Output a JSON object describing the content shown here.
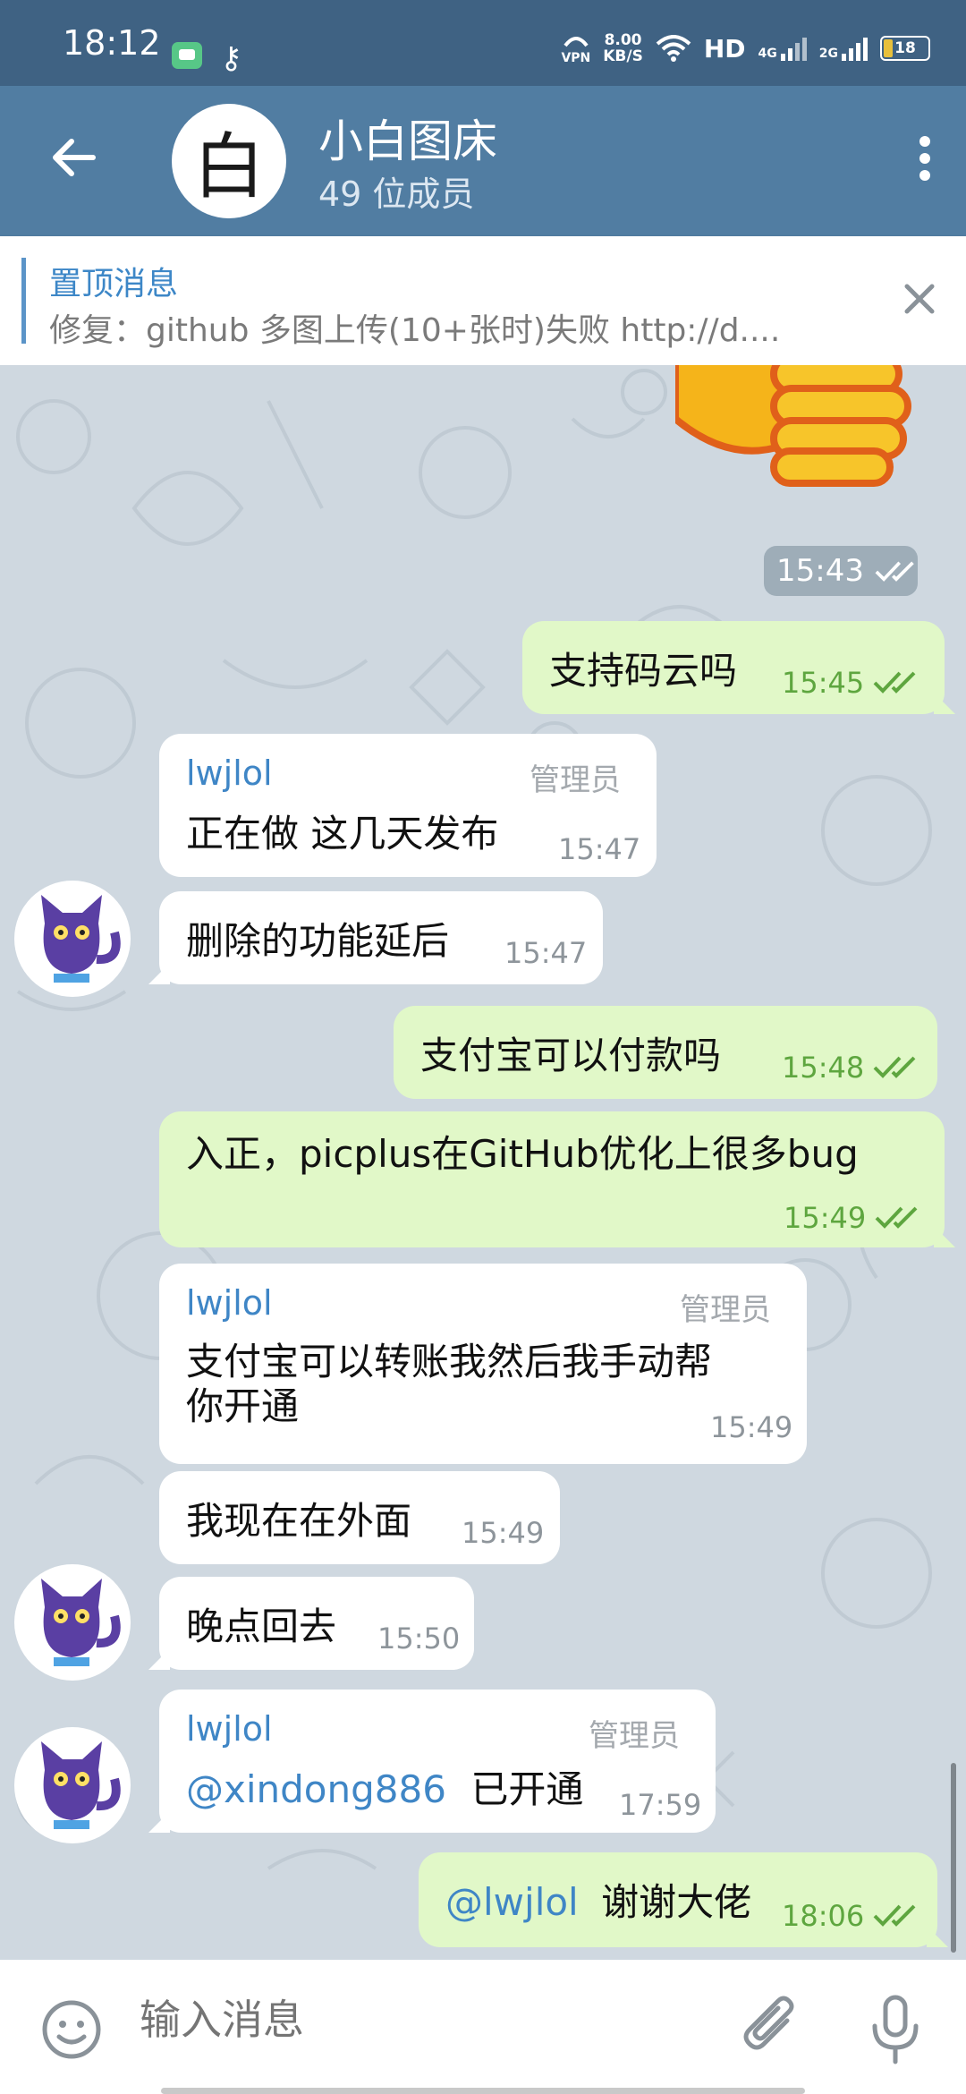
{
  "status_bar": {
    "time": "18:12",
    "vpn": "VPN",
    "speed_value": "8.00",
    "speed_unit": "KB/S",
    "hd": "HD",
    "net1": "4G",
    "net2": "2G",
    "battery": "18"
  },
  "header": {
    "avatar_char": "白",
    "title": "小白图床",
    "subtitle": "49 位成员"
  },
  "pinned": {
    "title": "置顶消息",
    "text": "修复：github 多图上传(10+张时)失败  http://d...."
  },
  "date_chip": "15:43",
  "messages": [
    {
      "dir": "out",
      "text": "支持码云吗",
      "time": "15:45"
    },
    {
      "dir": "in",
      "sender": "lwjlol",
      "role": "管理员",
      "text": "正在做 这几天发布",
      "time": "15:47"
    },
    {
      "dir": "in",
      "text": "删除的功能延后",
      "time": "15:47"
    },
    {
      "dir": "out",
      "text": "支付宝可以付款吗",
      "time": "15:48"
    },
    {
      "dir": "out",
      "text": "入正，picplus在GitHub优化上很多bug",
      "time": "15:49"
    },
    {
      "dir": "in",
      "sender": "lwjlol",
      "role": "管理员",
      "text_line1": "支付宝可以转账我然后我手动帮",
      "text_line2": "你开通",
      "time": "15:49"
    },
    {
      "dir": "in",
      "text": "我现在在外面",
      "time": "15:49"
    },
    {
      "dir": "in",
      "text": "晚点回去",
      "time": "15:50"
    },
    {
      "dir": "in",
      "sender": "lwjlol",
      "role": "管理员",
      "mention": "@xindong886",
      "text": "已开通",
      "time": "17:59"
    },
    {
      "dir": "out",
      "mention": "@lwjlol",
      "text": "谢谢大佬",
      "time": "18:06"
    }
  ],
  "input": {
    "placeholder": "输入消息"
  },
  "colors": {
    "header": "#517da2",
    "status_bar": "#3f6283",
    "outgoing_bubble": "#e1f8c8",
    "incoming_bubble": "#ffffff",
    "accent_link": "#3f86c6",
    "read_tick": "#5ea63f"
  },
  "icons": [
    "back-arrow-icon",
    "more-vert-icon",
    "close-icon",
    "thumbs-up-sticker",
    "double-check-icon",
    "cat-avatar",
    "emoji-icon",
    "paperclip-icon",
    "microphone-icon"
  ]
}
